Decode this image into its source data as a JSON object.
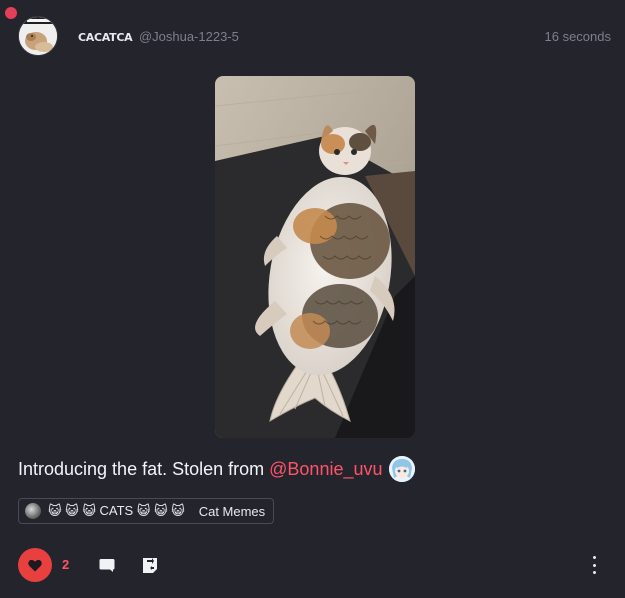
{
  "post": {
    "author": {
      "display_name": "CACatCA",
      "handle": "@Joshua-1223-5",
      "avatar_icon": "cat-avatar-icon"
    },
    "timestamp": "16 seconds",
    "unread_indicator_color": "#e43f5a",
    "caption": {
      "text": "Introducing the fat. Stolen from",
      "mention": "@Bonnie_uvu",
      "mention_color": "#ff5468"
    },
    "community": {
      "name": "😺 😺 😺 CATS 😺 😺 😺",
      "tag": "Cat Memes"
    },
    "actions": {
      "like_count": "2",
      "like_icon": "heart-icon",
      "comment_icon": "comment-icon",
      "share_icon": "share-icon",
      "more_icon": "more-vertical-icon",
      "like_color": "#e8403f"
    }
  }
}
